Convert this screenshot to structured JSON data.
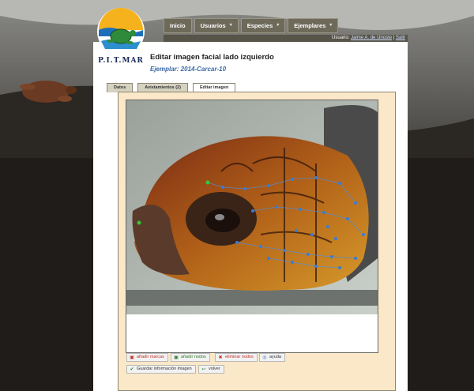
{
  "logo": {
    "text": "P.I.T.MAR"
  },
  "nav": {
    "items": [
      {
        "label": "Inicio",
        "has_caret": false
      },
      {
        "label": "Usuarios",
        "has_caret": true
      },
      {
        "label": "Especies",
        "has_caret": true
      },
      {
        "label": "Ejemplares",
        "has_caret": true
      }
    ],
    "caret": "▾"
  },
  "userbar": {
    "prefix": "Usuario:",
    "user": "Jaime A. de Urioste",
    "separator": "|",
    "logout": "Salir"
  },
  "page": {
    "title": "Editar imagen facial lado izquierdo",
    "specimen": "Ejemplar: 2014-Carcar-10"
  },
  "tabs": [
    {
      "label": "Datos",
      "active": false
    },
    {
      "label": "Avistamientos (2)",
      "active": false
    },
    {
      "label": "Editar imagen",
      "active": true
    }
  ],
  "actions": {
    "add_marks": "añadir marcas",
    "add_nodes": "añadir nodos",
    "delete_nodes": "eliminar nodos",
    "help": "ayuda",
    "save": "Guardar información imagen",
    "back": "volver"
  },
  "icons": {
    "add_marks": "image-edit-icon",
    "add_nodes": "image-add-icon",
    "delete_nodes": "red-x-icon",
    "help": "help-icon",
    "save": "checkmark-icon",
    "back": "arrow-back-icon"
  },
  "colors": {
    "panel_bg": "#ffffff",
    "tab_content_bg": "#fbe8c8",
    "nav_bg": "#6e6a5a",
    "node_blue": "#3a7bd5",
    "node_green": "#3cc43c",
    "specimen_link": "#3b6aa8"
  }
}
